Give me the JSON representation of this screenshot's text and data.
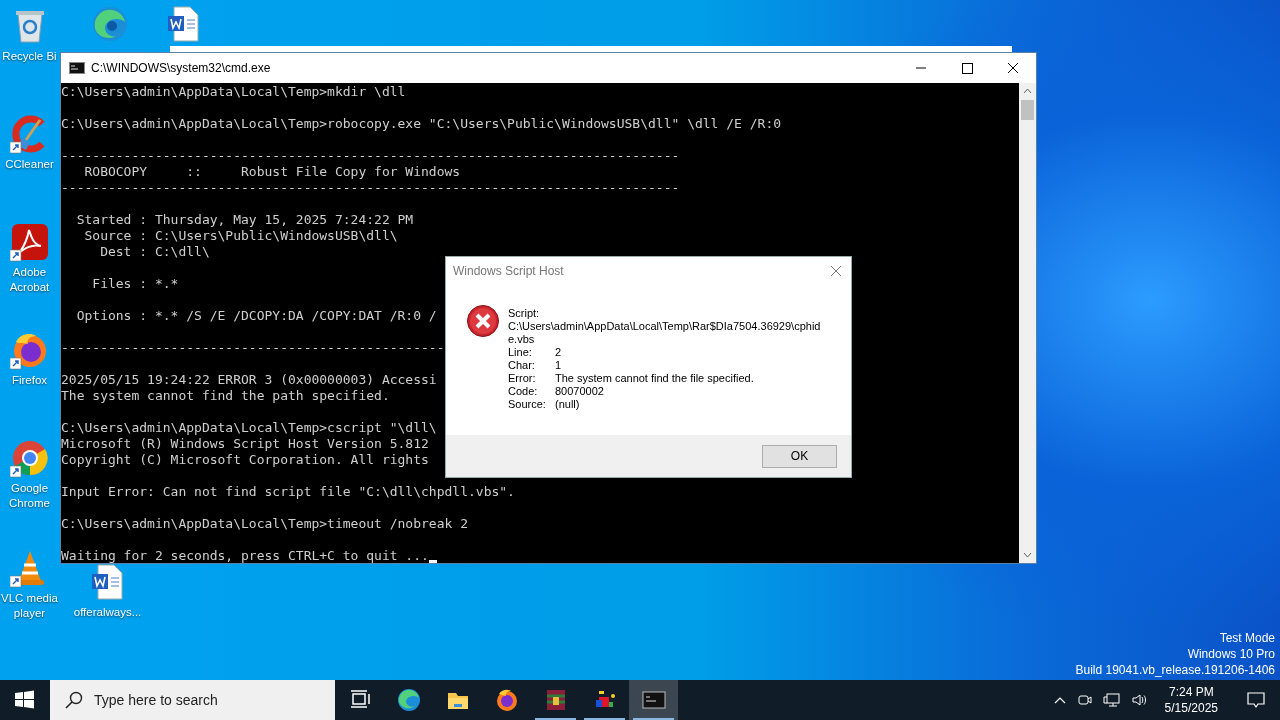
{
  "desktop": {
    "icons": [
      {
        "kind": "recycle-bin",
        "label": "Recycle Bi",
        "shortcut": false
      },
      {
        "kind": "edge",
        "shortcut": false
      },
      {
        "kind": "word",
        "shortcut": false
      },
      {
        "kind": "ccleaner",
        "label": "CCleaner",
        "shortcut": true
      },
      {
        "kind": "acrobat",
        "label": "Adobe Acrobat",
        "shortcut": true
      },
      {
        "kind": "firefox",
        "label": "Firefox",
        "shortcut": true
      },
      {
        "kind": "chrome",
        "label": "Google Chrome",
        "shortcut": true
      },
      {
        "kind": "vlc",
        "label": "VLC media player",
        "shortcut": true
      },
      {
        "kind": "word",
        "label": "offeralways...",
        "shortcut": false
      }
    ],
    "watermark_lines": [
      "Test Mode",
      "Windows 10 Pro",
      "Build 19041.vb_release.191206-1406"
    ]
  },
  "console_window": {
    "title": "C:\\WINDOWS\\system32\\cmd.exe",
    "cursor": true,
    "blocks": [
      [
        "C:\\Users\\admin\\AppData\\Local\\Temp>mkdir \\dll"
      ],
      [
        "C:\\Users\\admin\\AppData\\Local\\Temp>robocopy.exe \"C:\\Users\\Public\\WindowsUSB\\dll\" \\dll /E /R:0"
      ],
      [
        "-------------------------------------------------------------------------------",
        "   ROBOCOPY     ::     Robust File Copy for Windows",
        "-------------------------------------------------------------------------------"
      ],
      [
        "  Started : Thursday, May 15, 2025 7:24:22 PM",
        "   Source : C:\\Users\\Public\\WindowsUSB\\dll\\",
        "     Dest : C:\\dll\\"
      ],
      [
        "    Files : *.*"
      ],
      [
        "  Options : *.* /S /E /DCOPY:DA /COPY:DAT /R:0 /"
      ],
      [
        "-------------------------------------------------"
      ],
      [
        "2025/05/15 19:24:22 ERROR 3 (0x00000003) Accessi",
        "The system cannot find the path specified."
      ],
      [
        "C:\\Users\\admin\\AppData\\Local\\Temp>cscript \"\\dll\\",
        "Microsoft (R) Windows Script Host Version 5.812",
        "Copyright (C) Microsoft Corporation. All rights"
      ],
      [
        "Input Error: Can not find script file \"C:\\dll\\chpdll.vbs\"."
      ],
      [
        "C:\\Users\\admin\\AppData\\Local\\Temp>timeout /nobreak 2"
      ],
      [
        "Waiting for 2 seconds, press CTRL+C to quit ..."
      ]
    ]
  },
  "dialog": {
    "title": "Windows Script Host",
    "fields": [
      {
        "label": "Script:",
        "value": "C:\\Users\\admin\\AppData\\Local\\Temp\\Rar$DIa7504.36929\\cphide.vbs",
        "kind": "block"
      },
      {
        "label": "Line:",
        "value": "2",
        "kind": "inline"
      },
      {
        "label": "Char:",
        "value": "1",
        "kind": "inline"
      },
      {
        "label": "Error:",
        "value": "The system cannot find the file specified.",
        "kind": "inline"
      },
      {
        "label": "Code:",
        "value": "80070002",
        "kind": "inline"
      },
      {
        "label": "Source:",
        "value": "(null)",
        "kind": "inline"
      }
    ],
    "button": "OK"
  },
  "taskbar": {
    "search": {
      "placeholder": "Type here to search"
    },
    "apps": [
      {
        "kind": "task-view",
        "running": false,
        "selected": false
      },
      {
        "kind": "edge",
        "running": false,
        "selected": false
      },
      {
        "kind": "folder",
        "running": false,
        "selected": false
      },
      {
        "kind": "firefox",
        "running": false,
        "selected": false
      },
      {
        "kind": "winrar",
        "running": true,
        "selected": false
      },
      {
        "kind": "app",
        "running": true,
        "selected": false
      },
      {
        "kind": "cmd",
        "running": true,
        "selected": true
      }
    ],
    "time": "7:24 PM",
    "date": "5/15/2025"
  }
}
